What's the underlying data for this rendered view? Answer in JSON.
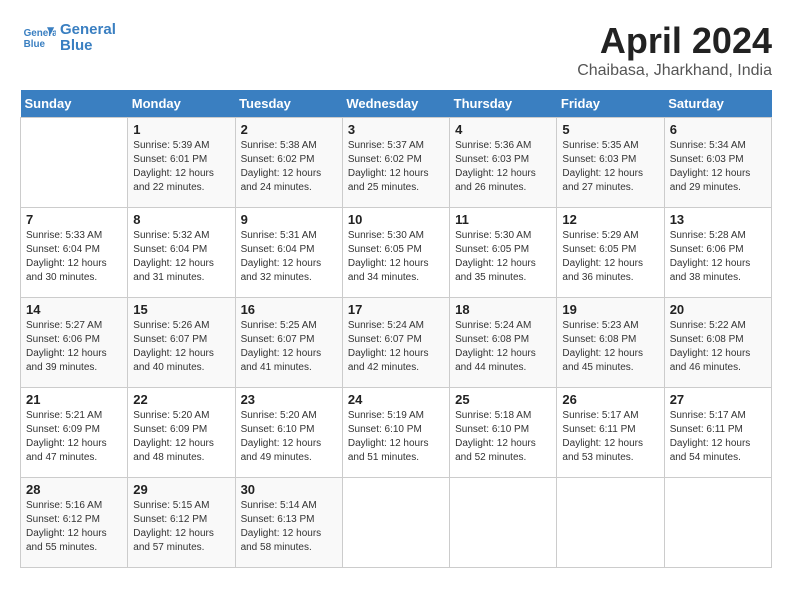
{
  "header": {
    "logo_line1": "General",
    "logo_line2": "Blue",
    "title": "April 2024",
    "subtitle": "Chaibasa, Jharkhand, India"
  },
  "weekdays": [
    "Sunday",
    "Monday",
    "Tuesday",
    "Wednesday",
    "Thursday",
    "Friday",
    "Saturday"
  ],
  "weeks": [
    [
      {
        "num": "",
        "info": ""
      },
      {
        "num": "1",
        "info": "Sunrise: 5:39 AM\nSunset: 6:01 PM\nDaylight: 12 hours\nand 22 minutes."
      },
      {
        "num": "2",
        "info": "Sunrise: 5:38 AM\nSunset: 6:02 PM\nDaylight: 12 hours\nand 24 minutes."
      },
      {
        "num": "3",
        "info": "Sunrise: 5:37 AM\nSunset: 6:02 PM\nDaylight: 12 hours\nand 25 minutes."
      },
      {
        "num": "4",
        "info": "Sunrise: 5:36 AM\nSunset: 6:03 PM\nDaylight: 12 hours\nand 26 minutes."
      },
      {
        "num": "5",
        "info": "Sunrise: 5:35 AM\nSunset: 6:03 PM\nDaylight: 12 hours\nand 27 minutes."
      },
      {
        "num": "6",
        "info": "Sunrise: 5:34 AM\nSunset: 6:03 PM\nDaylight: 12 hours\nand 29 minutes."
      }
    ],
    [
      {
        "num": "7",
        "info": "Sunrise: 5:33 AM\nSunset: 6:04 PM\nDaylight: 12 hours\nand 30 minutes."
      },
      {
        "num": "8",
        "info": "Sunrise: 5:32 AM\nSunset: 6:04 PM\nDaylight: 12 hours\nand 31 minutes."
      },
      {
        "num": "9",
        "info": "Sunrise: 5:31 AM\nSunset: 6:04 PM\nDaylight: 12 hours\nand 32 minutes."
      },
      {
        "num": "10",
        "info": "Sunrise: 5:30 AM\nSunset: 6:05 PM\nDaylight: 12 hours\nand 34 minutes."
      },
      {
        "num": "11",
        "info": "Sunrise: 5:30 AM\nSunset: 6:05 PM\nDaylight: 12 hours\nand 35 minutes."
      },
      {
        "num": "12",
        "info": "Sunrise: 5:29 AM\nSunset: 6:05 PM\nDaylight: 12 hours\nand 36 minutes."
      },
      {
        "num": "13",
        "info": "Sunrise: 5:28 AM\nSunset: 6:06 PM\nDaylight: 12 hours\nand 38 minutes."
      }
    ],
    [
      {
        "num": "14",
        "info": "Sunrise: 5:27 AM\nSunset: 6:06 PM\nDaylight: 12 hours\nand 39 minutes."
      },
      {
        "num": "15",
        "info": "Sunrise: 5:26 AM\nSunset: 6:07 PM\nDaylight: 12 hours\nand 40 minutes."
      },
      {
        "num": "16",
        "info": "Sunrise: 5:25 AM\nSunset: 6:07 PM\nDaylight: 12 hours\nand 41 minutes."
      },
      {
        "num": "17",
        "info": "Sunrise: 5:24 AM\nSunset: 6:07 PM\nDaylight: 12 hours\nand 42 minutes."
      },
      {
        "num": "18",
        "info": "Sunrise: 5:24 AM\nSunset: 6:08 PM\nDaylight: 12 hours\nand 44 minutes."
      },
      {
        "num": "19",
        "info": "Sunrise: 5:23 AM\nSunset: 6:08 PM\nDaylight: 12 hours\nand 45 minutes."
      },
      {
        "num": "20",
        "info": "Sunrise: 5:22 AM\nSunset: 6:08 PM\nDaylight: 12 hours\nand 46 minutes."
      }
    ],
    [
      {
        "num": "21",
        "info": "Sunrise: 5:21 AM\nSunset: 6:09 PM\nDaylight: 12 hours\nand 47 minutes."
      },
      {
        "num": "22",
        "info": "Sunrise: 5:20 AM\nSunset: 6:09 PM\nDaylight: 12 hours\nand 48 minutes."
      },
      {
        "num": "23",
        "info": "Sunrise: 5:20 AM\nSunset: 6:10 PM\nDaylight: 12 hours\nand 49 minutes."
      },
      {
        "num": "24",
        "info": "Sunrise: 5:19 AM\nSunset: 6:10 PM\nDaylight: 12 hours\nand 51 minutes."
      },
      {
        "num": "25",
        "info": "Sunrise: 5:18 AM\nSunset: 6:10 PM\nDaylight: 12 hours\nand 52 minutes."
      },
      {
        "num": "26",
        "info": "Sunrise: 5:17 AM\nSunset: 6:11 PM\nDaylight: 12 hours\nand 53 minutes."
      },
      {
        "num": "27",
        "info": "Sunrise: 5:17 AM\nSunset: 6:11 PM\nDaylight: 12 hours\nand 54 minutes."
      }
    ],
    [
      {
        "num": "28",
        "info": "Sunrise: 5:16 AM\nSunset: 6:12 PM\nDaylight: 12 hours\nand 55 minutes."
      },
      {
        "num": "29",
        "info": "Sunrise: 5:15 AM\nSunset: 6:12 PM\nDaylight: 12 hours\nand 57 minutes."
      },
      {
        "num": "30",
        "info": "Sunrise: 5:14 AM\nSunset: 6:13 PM\nDaylight: 12 hours\nand 58 minutes."
      },
      {
        "num": "",
        "info": ""
      },
      {
        "num": "",
        "info": ""
      },
      {
        "num": "",
        "info": ""
      },
      {
        "num": "",
        "info": ""
      }
    ]
  ]
}
